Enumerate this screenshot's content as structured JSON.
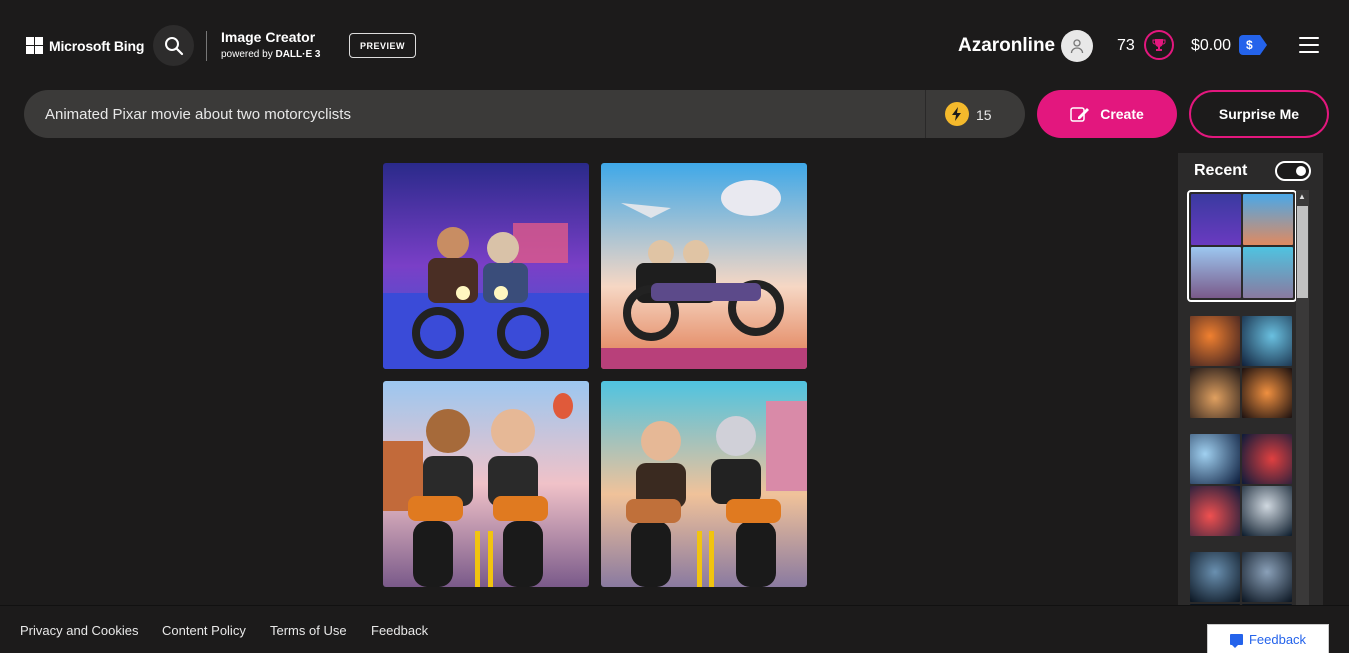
{
  "header": {
    "logo_text": "Microsoft Bing",
    "brand_title": "Image Creator",
    "brand_sub_prefix": "powered by",
    "brand_sub_model": "DALL·E 3",
    "preview_label": "PREVIEW",
    "user_name": "Azaronline",
    "rewards_count": "73",
    "balance": "$0.00",
    "balance_badge": "$"
  },
  "prompt": {
    "value": "Animated Pixar movie about two motorcyclists",
    "boosts": "15",
    "create_label": "Create",
    "surprise_label": "Surprise Me"
  },
  "recent": {
    "title": "Recent"
  },
  "footer": {
    "links": [
      "Privacy and Cookies",
      "Content Policy",
      "Terms of Use",
      "Feedback"
    ],
    "feedback_button": "Feedback"
  },
  "colors": {
    "accent": "#e3177e",
    "boost": "#f4b92c",
    "badge_blue": "#2463eb"
  }
}
